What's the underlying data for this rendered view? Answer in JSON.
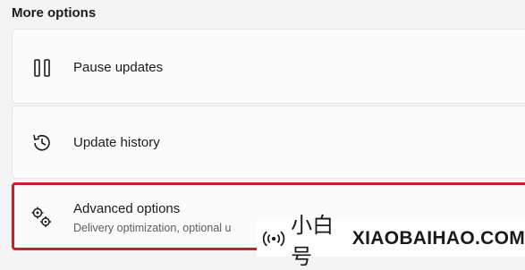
{
  "section": {
    "title": "More options"
  },
  "items": [
    {
      "label": "Pause updates",
      "icon": "pause-icon"
    },
    {
      "label": "Update history",
      "icon": "history-icon"
    },
    {
      "label": "Advanced options",
      "sublabel": "Delivery optimization, optional u",
      "icon": "gears-icon"
    }
  ],
  "watermark": {
    "brand": "小白号",
    "url": "XIAOBAIHAO.COM"
  },
  "colors": {
    "highlight": "#c0222e",
    "background": "#f3f3f3",
    "card": "#fbfbfb"
  }
}
